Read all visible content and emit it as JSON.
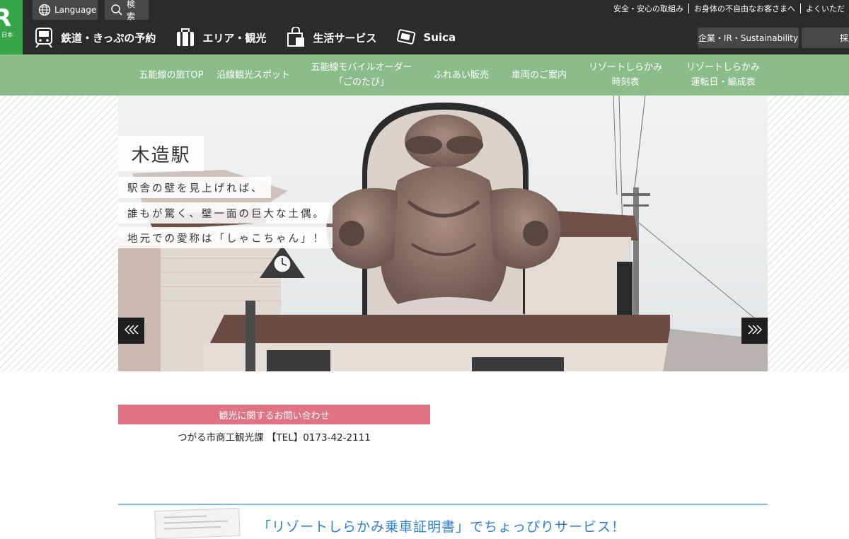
{
  "header": {
    "logo": {
      "letter": "R",
      "sub": "日本"
    },
    "language_label": "Language",
    "search_label": "検索",
    "util_links": [
      "安全・安心の取組み",
      "お身体の不自由なお客さまへ",
      "よくいただ"
    ],
    "main_nav": [
      {
        "label": "鉄道・きっぷの予約",
        "icon": "train-icon"
      },
      {
        "label": "エリア・観光",
        "icon": "luggage-icon"
      },
      {
        "label": "生活サービス",
        "icon": "shopping-bag-icon"
      },
      {
        "label": "Suica",
        "icon": "suica-card-icon"
      }
    ],
    "corporate_label": "企業・IR・Sustainability",
    "recruit_label": "採用"
  },
  "subnav": {
    "items": [
      "五能線の旅TOP",
      "沿線観光スポット",
      "五能線モバイルオーダー\n「ごのたび」",
      "ふれあい販売",
      "車両のご案内",
      "リゾートしらかみ\n時刻表",
      "リゾートしらかみ\n運転日・編成表"
    ]
  },
  "hero": {
    "title": "木造駅",
    "lines": [
      "駅舎の壁を見上げれば、",
      "誰もが驚く、壁一面の巨大な土偶。",
      "地元での愛称は「しゃこちゃん」！"
    ],
    "prev_glyph": "«",
    "next_glyph": "»"
  },
  "contact": {
    "heading": "観光に関するお問い合わせ",
    "body": "つがる市商工観光課 【TEL】0173-42-2111"
  },
  "promo": {
    "title": "「リゾートしらかみ乗車証明書」でちょっぴりサービス！"
  },
  "colors": {
    "header_bg": "#2b2b2b",
    "brand_green": "#37a648",
    "subnav_green": "#8bbd8a",
    "contact_pink": "#e07384",
    "promo_blue": "#2f7fcf"
  }
}
